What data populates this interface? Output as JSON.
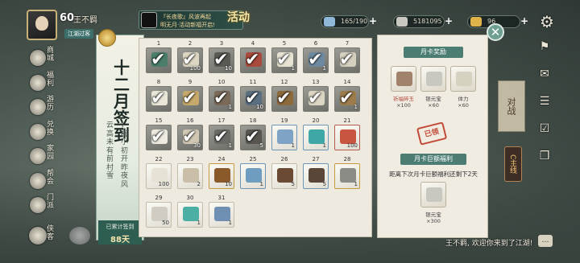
{
  "topbar": {
    "level": "60",
    "player_name": "王不羁",
    "sect_tag": "江湖过客",
    "event_line1": "『长夜歌』风波再起",
    "event_line2": "明无月·活动新福开启!",
    "event_badge": "活动",
    "currencies": [
      {
        "icon": "spirit-stone-icon",
        "value": "165/190",
        "color": "#8fb8d8"
      },
      {
        "icon": "silver-ingot-icon",
        "value": "5181095",
        "color": "#c8c8c0"
      },
      {
        "icon": "gold-ingot-icon",
        "value": "96",
        "color": "#e0b34a"
      }
    ]
  },
  "left_menu": [
    {
      "label": "商城",
      "icon": "shop-icon"
    },
    {
      "label": "福利",
      "icon": "gift-icon"
    },
    {
      "label": "游历",
      "icon": "travel-icon"
    },
    {
      "label": "兑换",
      "icon": "exchange-icon"
    },
    {
      "label": "家园",
      "icon": "home-icon"
    },
    {
      "label": "帮会",
      "icon": "guild-icon"
    },
    {
      "label": "门派",
      "icon": "sect-icon"
    }
  ],
  "chat_label": "侠客",
  "right_side": {
    "battle_label": "对战",
    "mainline_label": "C主线",
    "welcome": "王不羁, 欢迎你来到了江湖!"
  },
  "signin": {
    "title": "十二月签到",
    "poem_col1": "云高未有前村雪",
    "poem_col2": "，梅小初开昨夜风",
    "total_label": "已累计签到",
    "total_value": "88天"
  },
  "days": [
    {
      "day": "1",
      "qty": "",
      "checked": true,
      "color": "#4a7e6a",
      "tone": "dark"
    },
    {
      "day": "2",
      "qty": "100",
      "checked": true,
      "color": "#ddd6c2",
      "tone": "dark"
    },
    {
      "day": "3",
      "qty": "10",
      "checked": true,
      "color": "#5a5a55",
      "tone": "dark"
    },
    {
      "day": "4",
      "qty": "",
      "checked": true,
      "color": "#a84a3c",
      "tone": "dark"
    },
    {
      "day": "5",
      "qty": "1",
      "checked": true,
      "color": "#e8e3d3",
      "tone": "dark"
    },
    {
      "day": "6",
      "qty": "1",
      "checked": true,
      "color": "#6e8aa0",
      "tone": "dark"
    },
    {
      "day": "7",
      "qty": "",
      "checked": true,
      "color": "#d5cfbf",
      "tone": "dark"
    },
    {
      "day": "8",
      "qty": "",
      "checked": true,
      "color": "#eae6d8",
      "tone": "dark"
    },
    {
      "day": "9",
      "qty": "",
      "checked": true,
      "color": "#c6a86a",
      "tone": "dark"
    },
    {
      "day": "10",
      "qty": "1",
      "checked": true,
      "color": "#7b6a5a",
      "tone": "dark"
    },
    {
      "day": "11",
      "qty": "10",
      "checked": true,
      "color": "#5a6f80",
      "tone": "dark"
    },
    {
      "day": "12",
      "qty": "",
      "checked": true,
      "color": "#8e6b3c",
      "tone": "dark"
    },
    {
      "day": "13",
      "qty": "",
      "checked": true,
      "color": "#dcd5c4",
      "tone": "dark"
    },
    {
      "day": "14",
      "qty": "1",
      "checked": true,
      "color": "#9c7c4c",
      "tone": "dark"
    },
    {
      "day": "15",
      "qty": "",
      "checked": true,
      "color": "#eeeae0",
      "tone": "dark"
    },
    {
      "day": "16",
      "qty": "30",
      "checked": true,
      "color": "#d1c8b4",
      "tone": "dark"
    },
    {
      "day": "17",
      "qty": "1",
      "checked": true,
      "color": "#6a6a66",
      "tone": "dark"
    },
    {
      "day": "18",
      "qty": "5",
      "checked": true,
      "color": "#585550",
      "tone": "dark"
    },
    {
      "day": "19",
      "qty": "1",
      "checked": false,
      "color": "#7fa3c6",
      "tone": "blue"
    },
    {
      "day": "20",
      "qty": "1",
      "checked": false,
      "color": "#3fa7a6",
      "tone": "blue"
    },
    {
      "day": "21",
      "qty": "100",
      "checked": false,
      "color": "#c8553f",
      "tone": "red"
    },
    {
      "day": "22",
      "qty": "100",
      "checked": false,
      "color": "#e6e2d5",
      "tone": "open"
    },
    {
      "day": "23",
      "qty": "2",
      "checked": false,
      "color": "#c9bfa8",
      "tone": "open"
    },
    {
      "day": "24",
      "qty": "10",
      "checked": false,
      "color": "#8b5a2b",
      "tone": "gold"
    },
    {
      "day": "25",
      "qty": "1",
      "checked": false,
      "color": "#6e9dbf",
      "tone": "blue"
    },
    {
      "day": "26",
      "qty": "5",
      "checked": false,
      "color": "#6a4a33",
      "tone": "open"
    },
    {
      "day": "27",
      "qty": "5",
      "checked": false,
      "color": "#5a4638",
      "tone": "blue"
    },
    {
      "day": "28",
      "qty": "1",
      "checked": false,
      "color": "#8c8c86",
      "tone": "gold"
    },
    {
      "day": "29",
      "qty": "50",
      "checked": false,
      "color": "#d0ccc2",
      "tone": "open"
    },
    {
      "day": "30",
      "qty": "1",
      "checked": false,
      "color": "#4bb0a3",
      "tone": "open"
    },
    {
      "day": "31",
      "qty": "1",
      "checked": false,
      "color": "#6f90b3",
      "tone": "open"
    }
  ],
  "month_card": {
    "header": "月卡奖励",
    "rewards": [
      {
        "name": "祈福碎玉",
        "qty": "×100",
        "color": "#a0836a",
        "red": true
      },
      {
        "name": "银元宝",
        "qty": "×60",
        "color": "#c8c8c0",
        "red": false
      },
      {
        "name": "体力",
        "qty": "×60",
        "color": "#d6d2c2",
        "red": false
      }
    ],
    "claimed": "已领",
    "header2": "月卡巨额福利",
    "hint": "距离下次月卡巨额福利还剩下2天",
    "bonus": {
      "name": "银元宝",
      "qty": "×300",
      "color": "#c8c8c0"
    }
  }
}
